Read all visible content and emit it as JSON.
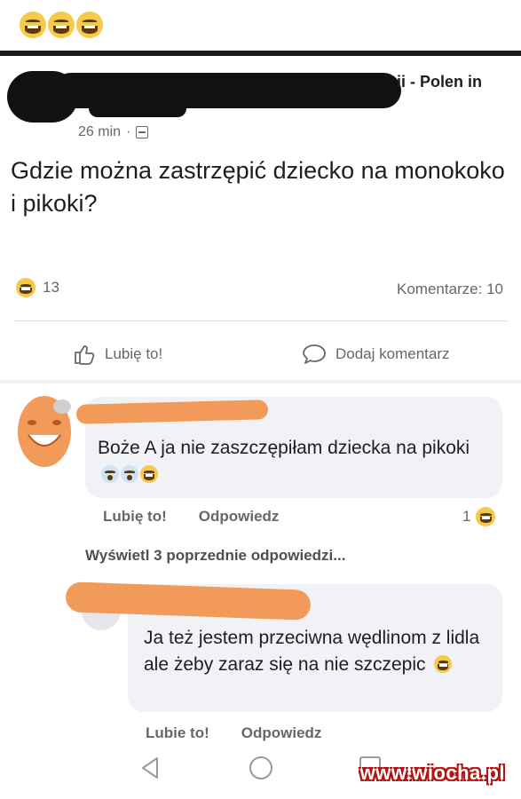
{
  "caption": {
    "emojis": [
      "grinning-sweat-emoji",
      "grinning-sweat-emoji",
      "grinning-sweat-emoji"
    ]
  },
  "post": {
    "author_suffix": "ii - Polen in",
    "time": "26 min",
    "separator": "·",
    "text": "Gdzie można zastrzępić dziecko na monokoko i pikoki?",
    "reaction_count": "13",
    "comments_label": "Komentarze: 10"
  },
  "actions": {
    "like": "Lubię to!",
    "comment": "Dodaj komentarz"
  },
  "comment1": {
    "text": "Boże A ja nie zaszczępiłam dziecka na pikoki",
    "like": "Lubię to!",
    "reply": "Odpowiedz",
    "reaction_count": "1"
  },
  "view_replies": "Wyświetl 3 poprzednie odpowiedzi...",
  "comment2": {
    "text": "Ja też jestem przeciwna wędlinom z lidla ale żeby zaraz się na nie szczepic",
    "like": "Lubie to!",
    "reply": "Odpowiedz"
  },
  "watermark": "www.wiocha.pl",
  "colors": {
    "text": "#1c1e21",
    "secondary": "#65676b",
    "bubble": "#f0f2f5",
    "redaction": "#f29a5a"
  }
}
